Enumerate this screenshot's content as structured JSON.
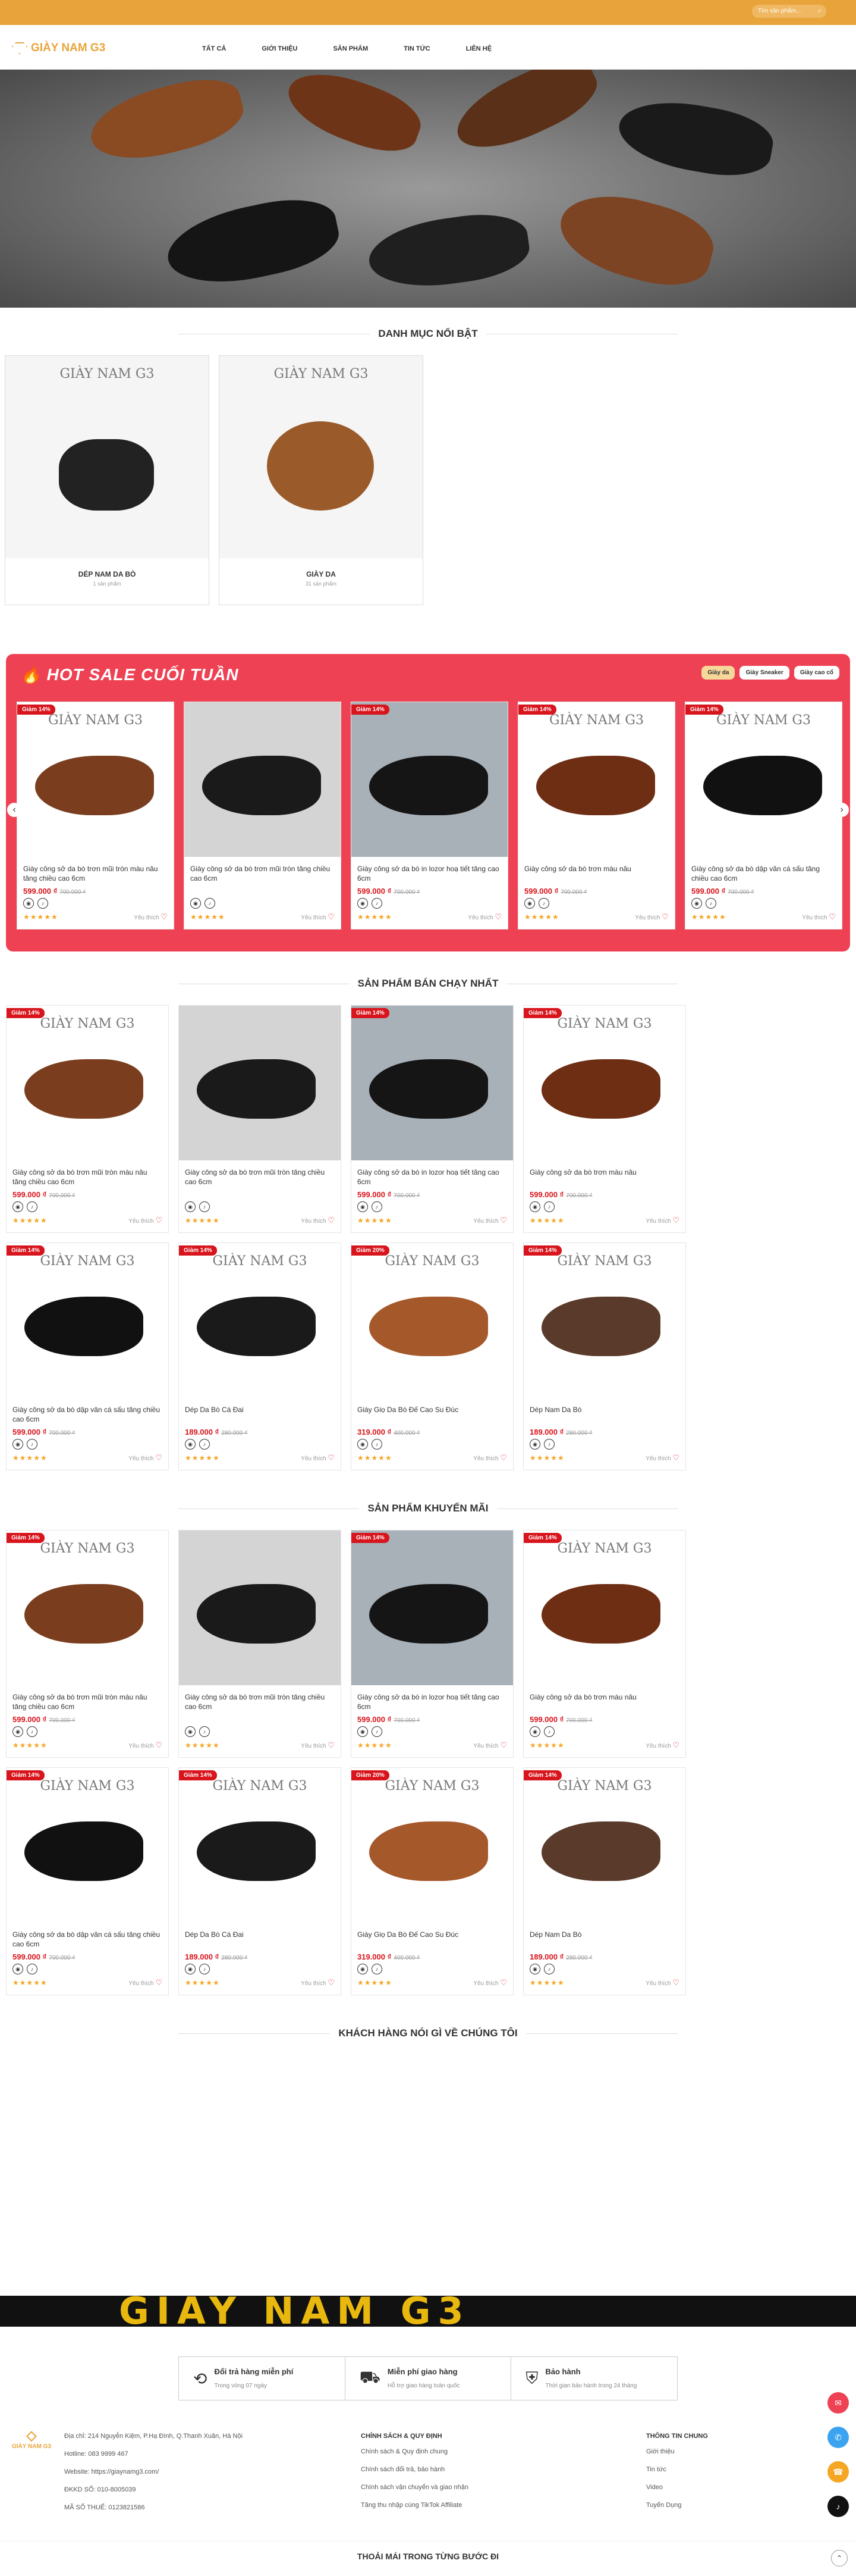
{
  "topbar": {
    "search_placeholder": "Tìm sản phẩm..."
  },
  "header": {
    "logo": "GIÀY NAM G3",
    "nav": [
      "TẤT CẢ",
      "GIỚI THIỆU",
      "SẢN PHẨM",
      "TIN TỨC",
      "LIÊN HỆ"
    ]
  },
  "sections": {
    "featured": "DANH MỤC NỔI BẬT",
    "bestseller": "SẢN PHẨM BÁN CHẠY NHẤT",
    "promo": "SẢN PHẨM KHUYẾN MÃI",
    "reviews": "KHÁCH HÀNG NÓI GÌ VỀ CHÚNG TÔI"
  },
  "brand_watermark": "GIÀY NAM G3",
  "categories": [
    {
      "name": "DÉP NAM DA BÒ",
      "count": "1 sản phẩm"
    },
    {
      "name": "GIÀY DA",
      "count": "31 sản phẩm"
    }
  ],
  "hot": {
    "title": "HOT SALE CUỐI TUẦN",
    "tabs": [
      "Giày da",
      "Giày Sneaker",
      "Giày cao cổ"
    ]
  },
  "products": [
    {
      "discount": "Giảm 14%",
      "title": "Giày công sở da bò trơn mũi tròn màu nâu tăng chiều cao 6cm",
      "price": "599.000 ₫",
      "old": "700.000 ₫",
      "color": "#7a3e1e",
      "bg": "#fff"
    },
    {
      "discount": "",
      "title": "Giày công sở da bò trơn mũi tròn tăng chiều cao 6cm",
      "price": "",
      "old": "",
      "color": "#1a1a1a",
      "bg": "#d4d4d4"
    },
    {
      "discount": "Giảm 14%",
      "title": "Giày công sở da bò in lozor hoạ tiết tăng cao 6cm",
      "price": "599.000 ₫",
      "old": "700.000 ₫",
      "color": "#151515",
      "bg": "#a8b0b8"
    },
    {
      "discount": "Giảm 14%",
      "title": "Giày công sở da bò trơn màu nâu",
      "price": "599.000 ₫",
      "old": "700.000 ₫",
      "color": "#6e2e14",
      "bg": "#fff"
    },
    {
      "discount": "Giảm 14%",
      "title": "Giày công sở da bò dập vân cá sấu tăng chiều cao 6cm",
      "price": "599.000 ₫",
      "old": "700.000 ₫",
      "color": "#111",
      "bg": "#fff"
    }
  ],
  "products2": [
    {
      "discount": "Giảm 14%",
      "title": "Dép Da Bò Cá Đai",
      "price": "189.000 ₫",
      "old": "280.000 ₫",
      "color": "#1a1a1a",
      "bg": "#fff"
    },
    {
      "discount": "Giảm 20%",
      "title": "Giày Giọ Da Bò Đế Cao Su Đúc",
      "price": "319.000 ₫",
      "old": "400.000 ₫",
      "color": "#a5582a",
      "bg": "#fff"
    },
    {
      "discount": "Giảm 14%",
      "title": "Dép Nam Da Bò",
      "price": "189.000 ₫",
      "old": "280.000 ₫",
      "color": "#5a3a2a",
      "bg": "#fff"
    }
  ],
  "card": {
    "like": "Yêu thích",
    "stars": "★★★★★",
    "icon_a": "◉",
    "icon_b": "♪"
  },
  "banner": "GIÀY NAM G3",
  "services": [
    {
      "title": "Đổi trả hàng miễn phí",
      "sub": "Trong vòng 07 ngày"
    },
    {
      "title": "Miễn phí giao hàng",
      "sub": "Hỗ trợ giao hàng toàn quốc"
    },
    {
      "title": "Bảo hành",
      "sub": "Thời gian bảo hành trong 24 tháng"
    }
  ],
  "footer": {
    "logo": "GIÀY NAM G3",
    "info": [
      "Địa chỉ: 214 Nguyễn Kiệm, P.Hạ Đình, Q.Thanh Xuân, Hà Nội",
      "Hotline: 083 9999 467",
      "Website: https://giaynamg3.com/",
      "ĐKKD SỐ: 010-8005039",
      "MÃ SỐ THUẾ: 0123821586"
    ],
    "policy_title": "CHÍNH SÁCH & QUY ĐỊNH",
    "policy": [
      "Chính sách & Quy định chung",
      "Chính sách đổi trả, bảo hành",
      "Chính sách vận chuyển và giao nhận",
      "Tăng thu nhập cùng TikTok Affiliate"
    ],
    "general_title": "THÔNG TIN CHUNG",
    "general": [
      "Giới thiệu",
      "Tin tức",
      "Video",
      "Tuyển Dụng"
    ],
    "bottom": "THOẢI MÁI TRONG TỪNG BƯỚC ĐI"
  }
}
